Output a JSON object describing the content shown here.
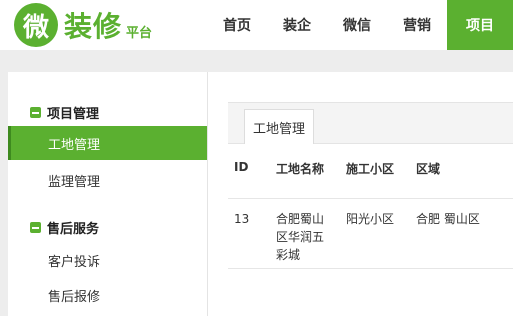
{
  "logo": {
    "badge": "微",
    "name": "装修",
    "sub": "平台"
  },
  "nav": [
    "首页",
    "装企",
    "微信",
    "营销",
    "项目"
  ],
  "sidebar": {
    "groups": [
      {
        "title": "项目管理",
        "items": [
          "工地管理",
          "监理管理"
        ]
      },
      {
        "title": "售后服务",
        "items": [
          "客户投诉",
          "售后报修"
        ]
      }
    ]
  },
  "tab": "工地管理",
  "table": {
    "headers": [
      "ID",
      "工地名称",
      "施工小区",
      "区域"
    ],
    "rows": [
      {
        "id": "13",
        "name": "合肥蜀山区华润五彩城",
        "community": "阳光小区",
        "area": "合肥 蜀山区"
      }
    ]
  },
  "colors": {
    "accent": "#5bb030"
  }
}
